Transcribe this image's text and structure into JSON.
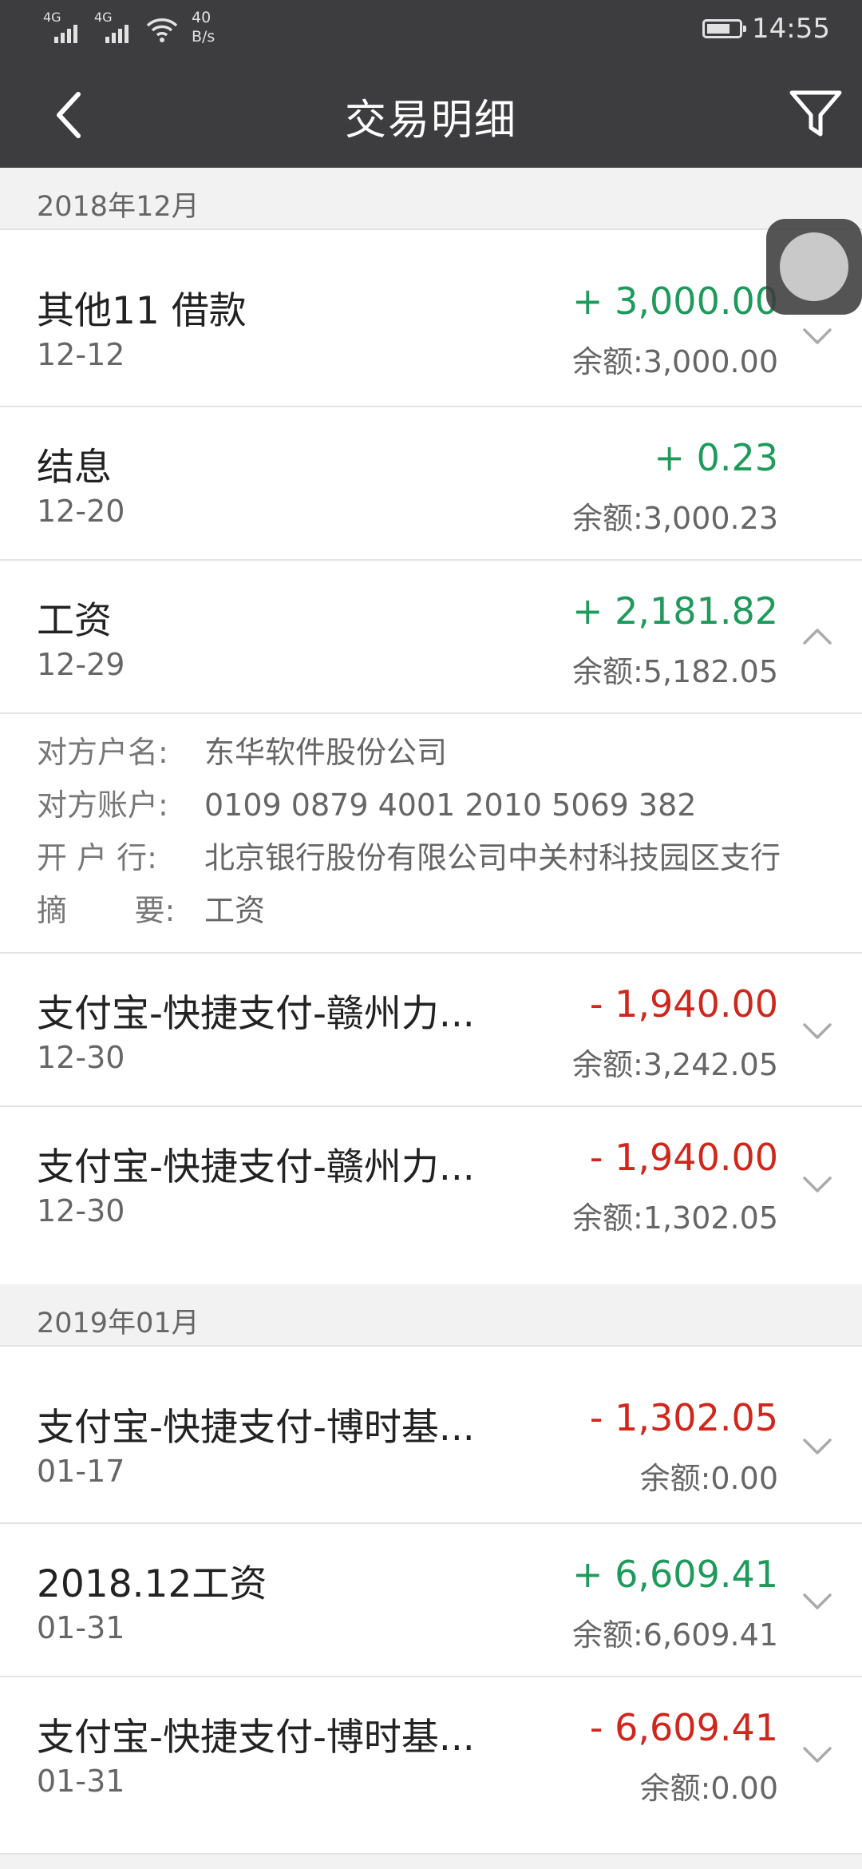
{
  "status_bar": {
    "signal1": "4G",
    "signal2": "4G",
    "net_speed_value": "40",
    "net_speed_unit": "B/s",
    "time": "14:55"
  },
  "nav": {
    "title": "交易明细",
    "back_icon": "chevron-left-icon",
    "filter_icon": "filter-funnel-icon"
  },
  "months": [
    {
      "label": "2018年12月",
      "transactions": [
        {
          "name": "其他11 借款",
          "date": "12-12",
          "amount": "+ 3,000.00",
          "balance": "余额:3,000.00",
          "type": "credit"
        },
        {
          "name": "结息",
          "date": "12-20",
          "amount": "+ 0.23",
          "balance": "余额:3,000.23",
          "type": "credit"
        },
        {
          "name": "工资",
          "date": "12-29",
          "amount": "+ 2,181.82",
          "balance": "余额:5,182.05",
          "type": "credit",
          "expanded": true,
          "details": [
            {
              "label": "对方户名:",
              "value": "东华软件股份公司"
            },
            {
              "label": "对方账户:",
              "value": "0109 0879 4001 2010 5069 382"
            },
            {
              "label": "开 户 行:",
              "value": "北京银行股份有限公司中关村科技园区支行"
            },
            {
              "label": "摘       要:",
              "value": "工资"
            }
          ]
        },
        {
          "name": "支付宝-快捷支付-赣州力...",
          "date": "12-30",
          "amount": "- 1,940.00",
          "balance": "余额:3,242.05",
          "type": "debit"
        },
        {
          "name": "支付宝-快捷支付-赣州力...",
          "date": "12-30",
          "amount": "- 1,940.00",
          "balance": "余额:1,302.05",
          "type": "debit"
        }
      ]
    },
    {
      "label": "2019年01月",
      "transactions": [
        {
          "name": "支付宝-快捷支付-博时基...",
          "date": "01-17",
          "amount": "- 1,302.05",
          "balance": "余额:0.00",
          "type": "debit"
        },
        {
          "name": "2018.12工资",
          "date": "01-31",
          "amount": "+ 6,609.41",
          "balance": "余额:6,609.41",
          "type": "credit"
        },
        {
          "name": "支付宝-快捷支付-博时基...",
          "date": "01-31",
          "amount": "- 6,609.41",
          "balance": "余额:0.00",
          "type": "debit"
        }
      ]
    }
  ],
  "colors": {
    "header_bg": "#3d3d3f",
    "credit": "#1e9a5b",
    "debit": "#d0261c"
  }
}
